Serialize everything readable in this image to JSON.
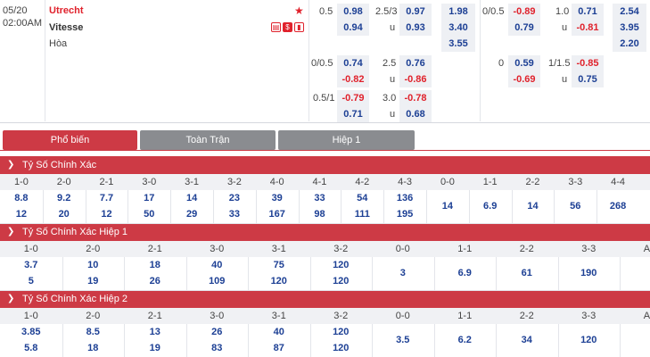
{
  "match": {
    "date": "05/20",
    "time": "02:00AM",
    "home": "Utrecht",
    "away": "Vitesse",
    "draw": "Hòa"
  },
  "odds": {
    "ft_hdp": [
      {
        "line": "0.5",
        "home": "0.98",
        "away": "0.94"
      },
      {
        "line": "0/0.5",
        "home": "0.74",
        "away": "-0.82"
      },
      {
        "line": "0.5/1",
        "home": "-0.79",
        "away": "0.71"
      }
    ],
    "ft_ou": [
      {
        "line": "2.5/3",
        "over": "0.97",
        "u": "u",
        "under": "0.93"
      },
      {
        "line": "2.5",
        "over": "0.76",
        "u": "u",
        "under": "-0.86"
      },
      {
        "line": "3.0",
        "over": "-0.78",
        "u": "u",
        "under": "0.68"
      }
    ],
    "ft_1x2": [
      "1.98",
      "3.40",
      "3.55"
    ],
    "h1_hdp": [
      {
        "line": "0/0.5",
        "home": "-0.89",
        "away": "0.79"
      },
      {
        "line": "0",
        "home": "0.59",
        "away": "-0.69"
      }
    ],
    "h1_ou": [
      {
        "line": "1.0",
        "over": "0.71",
        "u": "u",
        "under": "-0.81"
      },
      {
        "line": "1/1.5",
        "over": "-0.85",
        "u": "u",
        "under": "0.75"
      }
    ],
    "h1_1x2": [
      "2.54",
      "3.95",
      "2.20"
    ]
  },
  "tabs": [
    "Phổ biến",
    "Toàn Trận",
    "Hiệp 1"
  ],
  "sections": [
    {
      "title": "Tỷ Số Chính Xác",
      "headers": [
        "1-0",
        "2-0",
        "2-1",
        "3-0",
        "3-1",
        "3-2",
        "4-0",
        "4-1",
        "4-2",
        "4-3",
        "0-0",
        "1-1",
        "2-2",
        "3-3",
        "4-4"
      ],
      "top": [
        "8.8",
        "9.2",
        "7.7",
        "17",
        "14",
        "23",
        "39",
        "33",
        "54",
        "136"
      ],
      "bottom": [
        "12",
        "20",
        "12",
        "50",
        "29",
        "33",
        "167",
        "98",
        "111",
        "195"
      ],
      "mid": [
        "14",
        "6.9",
        "14",
        "56",
        "268"
      ]
    },
    {
      "title": "Tỷ Số Chính Xác Hiệp 1",
      "headers": [
        "1-0",
        "2-0",
        "2-1",
        "3-0",
        "3-1",
        "3-2",
        "0-0",
        "1-1",
        "2-2",
        "3-3",
        "AO"
      ],
      "top": [
        "3.7",
        "10",
        "18",
        "40",
        "75",
        "120"
      ],
      "bottom": [
        "5",
        "19",
        "26",
        "109",
        "120",
        "120"
      ],
      "mid": [
        "3",
        "6.9",
        "61",
        "190"
      ]
    },
    {
      "title": "Tỷ Số Chính Xác Hiệp 2",
      "headers": [
        "1-0",
        "2-0",
        "2-1",
        "3-0",
        "3-1",
        "3-2",
        "0-0",
        "1-1",
        "2-2",
        "3-3",
        "AO"
      ],
      "top": [
        "3.85",
        "8.5",
        "13",
        "26",
        "40",
        "120"
      ],
      "bottom": [
        "5.8",
        "18",
        "19",
        "83",
        "87",
        "120"
      ],
      "mid": [
        "3.5",
        "6.2",
        "34",
        "120"
      ]
    }
  ]
}
